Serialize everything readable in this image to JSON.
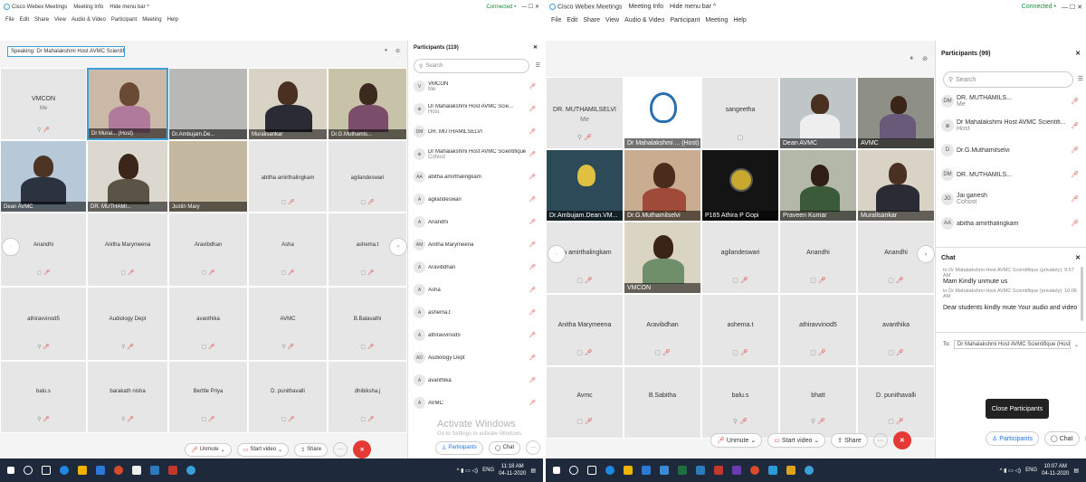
{
  "left": {
    "title": {
      "app": "Cisco Webex Meetings",
      "meeting_info": "Meeting Info",
      "hide_menu": "Hide menu bar ^",
      "connected": "Connected •",
      "controls": "— ☐ ✕"
    },
    "menu": [
      "File",
      "Edit",
      "Share",
      "View",
      "Audio & Video",
      "Participant",
      "Meeting",
      "Help"
    ],
    "speaking": "Speaking: Dr Mahalakshmi Host AVMC Scientifique (...",
    "video_tiles": [
      {
        "label": "Dr Mural... (Host)"
      },
      {
        "label": "Dr.Ambujam.De..."
      },
      {
        "label": "Muralisankar"
      },
      {
        "label": "Dr.G.Muthamis..."
      },
      {
        "label": "Dean AVMC"
      },
      {
        "label": "DR. MUTHAMI..."
      },
      {
        "label": "Justin Mary"
      }
    ],
    "vmcon": {
      "name": "VMCON",
      "sub": "Me"
    },
    "name_tiles": [
      "abitha amirthalingkam",
      "agilandeswari",
      "Anandhi",
      "Anitha Marymeena",
      "Aravibdhan",
      "Asha",
      "ashema.t",
      "athiravvinod5",
      "Audiology Dept",
      "avanthika",
      "AVMC",
      "B.Balavathi",
      "balu.s",
      "barakath nisha",
      "Berttle Priya",
      "D. punithavalli",
      "dhibiksha.j"
    ],
    "controls": {
      "unmute": "Unmute",
      "start_video": "Start video",
      "share": "Share",
      "more": "···",
      "end": "✕"
    },
    "participants": {
      "header": "Participants (119)",
      "search_placeholder": "Search",
      "rows": [
        {
          "init": "V",
          "name": "VMCON",
          "role": "Me"
        },
        {
          "init": "⊕",
          "name": "Dr Mahalakshmi Host AVMC Scie...",
          "role": "Host"
        },
        {
          "init": "DM",
          "name": "DR. MUTHAMILSELVI",
          "role": ""
        },
        {
          "init": "⊕",
          "name": "Dr Mahalakshmi Host AVMC Scientifique",
          "role": "Cohost"
        },
        {
          "init": "AA",
          "name": "abitha amirthalingkam",
          "role": ""
        },
        {
          "init": "A",
          "name": "agilandeswari",
          "role": ""
        },
        {
          "init": "A",
          "name": "Anandhi",
          "role": ""
        },
        {
          "init": "AM",
          "name": "Anitha Marymeena",
          "role": ""
        },
        {
          "init": "A",
          "name": "Aravibdhan",
          "role": ""
        },
        {
          "init": "A",
          "name": "Asha",
          "role": ""
        },
        {
          "init": "A",
          "name": "ashema.t",
          "role": ""
        },
        {
          "init": "A",
          "name": "athiravvinod5",
          "role": ""
        },
        {
          "init": "AD",
          "name": "Audiology Dept",
          "role": ""
        },
        {
          "init": "A",
          "name": "avanthika",
          "role": ""
        },
        {
          "init": "A",
          "name": "AVMC",
          "role": ""
        }
      ],
      "footer_participants": "Participants",
      "footer_chat": "Chat"
    },
    "watermark": {
      "line1": "Activate Windows",
      "line2": "Go to Settings to activate Windows."
    },
    "tray": {
      "lang": "ENG",
      "time": "11:18 AM",
      "date": "04-11-2020"
    }
  },
  "right": {
    "title": {
      "app": "Cisco Webex Meetings",
      "meeting_info": "Meeting Info",
      "hide_menu": "Hide menu bar ^",
      "connected": "Connected •",
      "controls": "— ☐ ✕"
    },
    "menu": [
      "File",
      "Edit",
      "Share",
      "View",
      "Audio & Video",
      "Participant",
      "Meeting",
      "Help"
    ],
    "top_tiles": [
      {
        "name": "DR. MUTHAMILSELVI",
        "sub": "Me"
      },
      {
        "name": "sangeetha",
        "sub": ""
      }
    ],
    "video_tiles": [
      {
        "label": "Dr Mahalakshmi ... (Host)"
      },
      {
        "label": "Dean AVMC"
      },
      {
        "label": "AVMC"
      },
      {
        "label": "Dr.Ambujam.Dean.VM..."
      },
      {
        "label": "Dr.G.Muthamilselvi"
      },
      {
        "label": "P165 Athira P Gopi"
      },
      {
        "label": "Praveen Kumar"
      },
      {
        "label": "Muralisankar"
      },
      {
        "label": "VMCON"
      }
    ],
    "name_tiles": [
      "tha amirthalingkam",
      "agilandeswari",
      "Anandhi",
      "Anandhi",
      "Anitha Marymeena",
      "Aravibdhan",
      "ashema.t",
      "athiravvinod5",
      "avanthika",
      "Avmc",
      "B.Sabitha",
      "balu.s",
      "bhatt",
      "D. punithavalli"
    ],
    "controls": {
      "unmute": "Unmute",
      "start_video": "Start video",
      "share": "Share",
      "more": "···",
      "end": "✕"
    },
    "participants": {
      "header": "Participants (99)",
      "search_placeholder": "Search",
      "rows": [
        {
          "init": "DM",
          "name": "DR. MUTHAMILS...",
          "role": "Me"
        },
        {
          "init": "⊕",
          "name": "Dr Mahalakshmi Host AVMC Scientifi...",
          "role": "Host"
        },
        {
          "init": "D",
          "name": "Dr.G.Muthamilselvi",
          "role": ""
        },
        {
          "init": "DM",
          "name": "DR. MUTHAMILS...",
          "role": ""
        },
        {
          "init": "JG",
          "name": "Jai ganesh",
          "role": "Cohost"
        },
        {
          "init": "AA",
          "name": "abitha amirthalingkam",
          "role": ""
        }
      ]
    },
    "chat": {
      "header": "Chat",
      "meta1": "to Dr Mahalakshmi Host AVMC Scientifique (privately):",
      "time1": "9:57 AM",
      "msg1": "Mam Kindly unmute us",
      "meta2": "to Dr Mahalakshmi Host AVMC Scientifique (privately):",
      "time2": "10:06 AM",
      "msg2": "Dear students kindly mute  Your audio and video",
      "to_label": "To:",
      "to_value": "Dr Mahalakshmi Host AVMC Scientifique (Host)"
    },
    "tooltip": "Close Participants",
    "footer_participants": "Participants",
    "footer_chat": "Chat",
    "tray": {
      "lang": "ENG",
      "time": "10:07 AM",
      "date": "04-11-2020"
    }
  },
  "colors": {
    "accent": "#1a73e8",
    "end_call": "#e53935",
    "taskbar": "#1e2a3c",
    "connected": "#1a8f3c"
  }
}
